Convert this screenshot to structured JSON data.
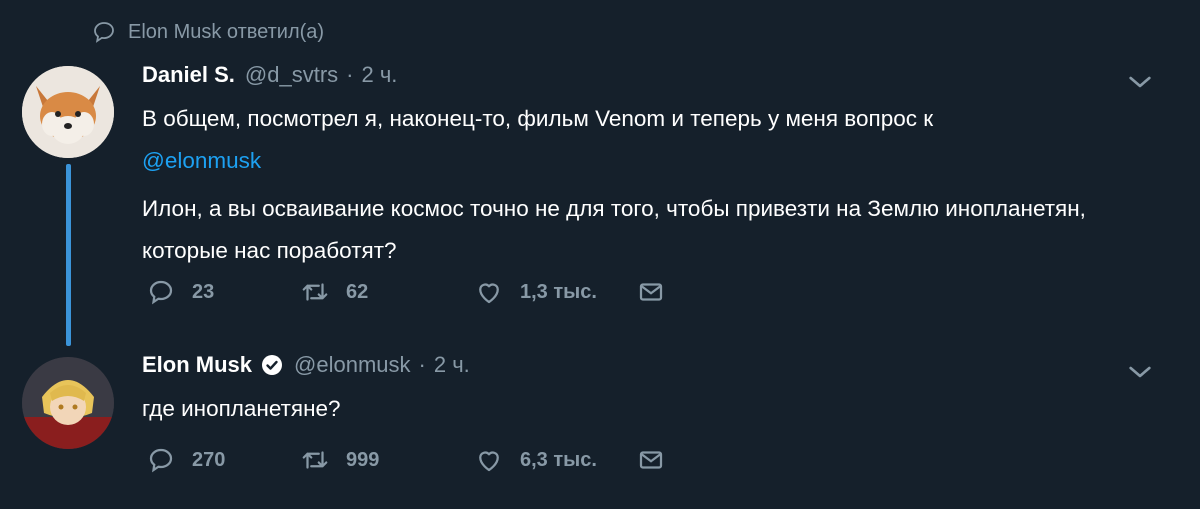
{
  "reply_context": {
    "text": "Elon Musk ответил(а)"
  },
  "tweets": [
    {
      "name": "Daniel S.",
      "handle": "@d_svtrs",
      "time": "2 ч.",
      "text_part1": "В общем, посмотрел я, наконец-то, фильм Venom и теперь у меня вопрос к",
      "mention": "@elonmusk",
      "text_part2": "Илон, а вы осваивание космос точно не для того, чтобы привезти на Землю инопланетян, которые нас поработят?",
      "replies": "23",
      "retweets": "62",
      "likes": "1,3 тыс."
    },
    {
      "name": "Elon Musk",
      "handle": "@elonmusk",
      "time": "2 ч.",
      "verified": true,
      "text": "где инопланетяне?",
      "replies": "270",
      "retweets": "999",
      "likes": "6,3 тыс."
    }
  ],
  "colors": {
    "background": "#15202b",
    "secondary_text": "#8899a6",
    "link": "#1da1f2",
    "thread_line": "#3b94d9"
  }
}
